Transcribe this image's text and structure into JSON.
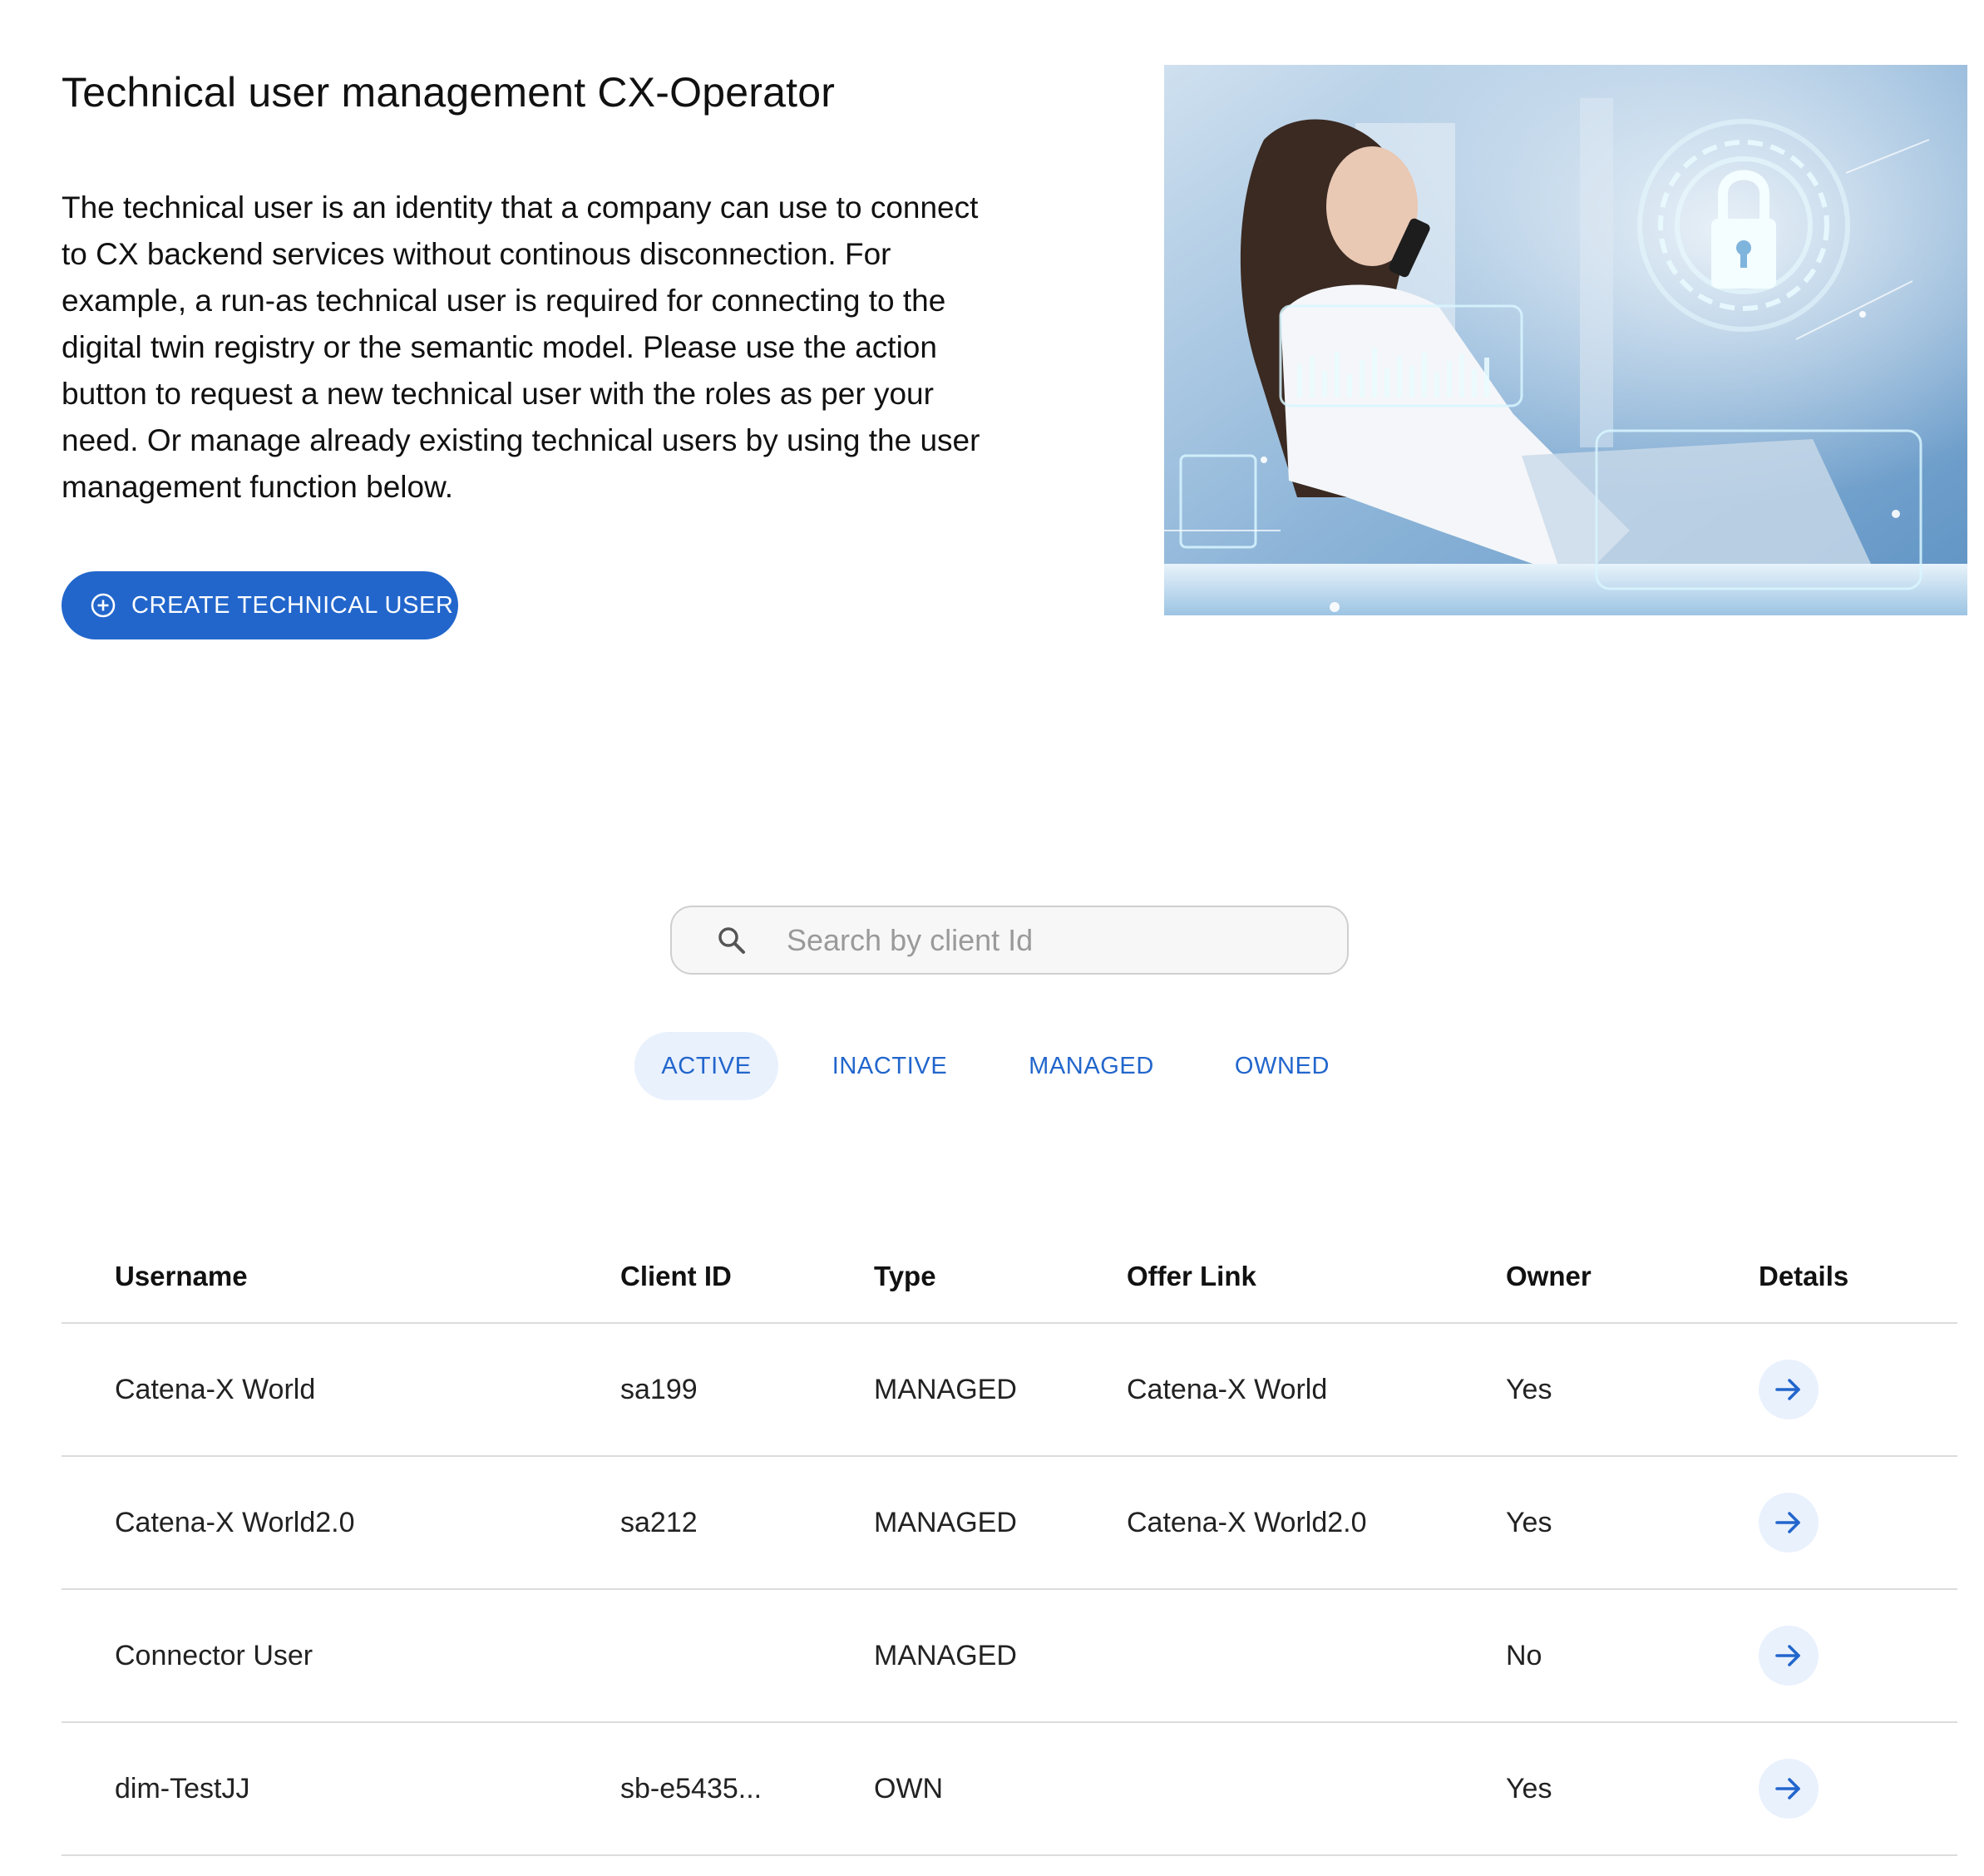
{
  "header": {
    "title": "Technical user management CX-Operator",
    "description": "The technical user is an identity that a company can use to connect to CX backend services without continous disconnection. For example, a run-as technical user is required for connecting to the digital twin registry or the semantic model. Please use the action button to request a new technical user with the roles as per your need. Or manage already existing technical users by using the user management function below.",
    "create_button_label": "CREATE TECHNICAL USER",
    "create_button_icon": "plus-circle-icon"
  },
  "search": {
    "placeholder": "Search by client Id",
    "value": "",
    "icon": "search-icon"
  },
  "tabs": [
    {
      "label": "ACTIVE",
      "selected": true
    },
    {
      "label": "INACTIVE",
      "selected": false
    },
    {
      "label": "MANAGED",
      "selected": false
    },
    {
      "label": "OWNED",
      "selected": false
    }
  ],
  "table": {
    "columns": [
      "Username",
      "Client ID",
      "Type",
      "Offer Link",
      "Owner",
      "Details"
    ],
    "rows": [
      {
        "username": "Catena-X World",
        "client_id": "sa199",
        "type": "MANAGED",
        "offer_link": "Catena-X World",
        "owner": "Yes"
      },
      {
        "username": "Catena-X World2.0",
        "client_id": "sa212",
        "type": "MANAGED",
        "offer_link": "Catena-X World2.0",
        "owner": "Yes"
      },
      {
        "username": "Connector User",
        "client_id": "",
        "type": "MANAGED",
        "offer_link": "",
        "owner": "No"
      },
      {
        "username": "dim-TestJJ",
        "client_id": "sb-e5435...",
        "type": "OWN",
        "offer_link": "",
        "owner": "Yes"
      }
    ],
    "details_icon": "arrow-right-icon"
  },
  "colors": {
    "primary": "#2266cc",
    "tab_active_bg": "#e9f1fd",
    "divider": "#dcdcdc"
  }
}
